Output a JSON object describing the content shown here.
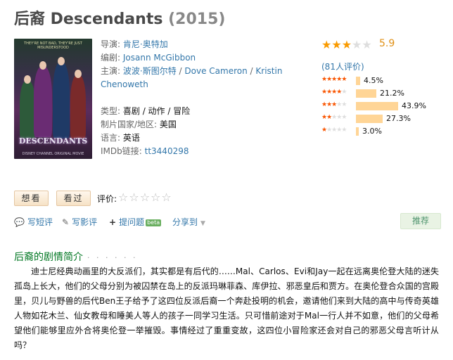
{
  "movie": {
    "title": "后裔 Descendants",
    "year": "(2015)"
  },
  "poster": {
    "tagline": "THEY'RE NOT BAD, THEY'RE JUST MISUNDERSTOOD",
    "logo_text": "DESCENDANTS",
    "bottom_text": "DISNEY CHANNEL ORIGINAL MOVIE"
  },
  "info": {
    "director_label": "导演:",
    "director": "肯尼·奥特加",
    "writer_label": "编剧:",
    "writer": "Josann McGibbon",
    "cast_label": "主演:",
    "cast": [
      "波波·斯图尔特",
      "Dove Cameron",
      "Kristin Chenoweth"
    ],
    "cast_sep": "/",
    "genre_label": "类型:",
    "genre": "喜剧 / 动作 / 冒险",
    "country_label": "制片国家/地区:",
    "country": "美国",
    "language_label": "语言:",
    "language": "英语",
    "imdb_label": "IMDb链接:",
    "imdb": "tt3440298"
  },
  "rating": {
    "score": "5.9",
    "stars_filled": 3,
    "stars_total": 5,
    "count_text": "(81人评价)",
    "distribution": [
      {
        "stars": 5,
        "percent": 4.5,
        "label": "4.5%"
      },
      {
        "stars": 4,
        "percent": 21.2,
        "label": "21.2%"
      },
      {
        "stars": 3,
        "percent": 43.9,
        "label": "43.9%"
      },
      {
        "stars": 2,
        "percent": 27.3,
        "label": "27.3%"
      },
      {
        "stars": 1,
        "percent": 3.0,
        "label": "3.0%"
      }
    ],
    "colors": {
      "star_on": "#f99b01",
      "star_off": "#dedede",
      "bar": "#ffd596",
      "score": "#e09015"
    }
  },
  "actions": {
    "want_label": "想看",
    "seen_label": "看过",
    "rate_label": "评价:",
    "rate_stars": "☆☆☆☆☆"
  },
  "toolbar": {
    "short_review": "写短评",
    "review": "写影评",
    "ask": "提问题",
    "ask_badge": "beta",
    "share": "分享到",
    "recommend": "推荐"
  },
  "synopsis": {
    "heading": "后裔的剧情简介",
    "dots": "· · · · · ·",
    "text": "迪士尼经典动画里的大反派们，其实都是有后代的……Mal、Carlos、Evi和Jay一起在远离奥伦登大陆的迷失孤岛上长大，他们的父母分别为被囚禁在岛上的反派玛琳菲森、库伊拉、邪恶皇后和贾方。在奥伦登合众国的宫殿里，贝儿与野兽的后代Ben王子给予了这四位反派后裔一个奔赴投明的机会，邀请他们来到大陆的高中与传奇英雄人物如花木兰、仙女教母和睡美人等人的孩子一同学习生活。只可惜前途对于Mal一行人并不如意，他们的父母希望他们能够里应外合将奥伦登一举摧毁。事情经过了重重变故，这四位小冒险家还会对自己的邪恶父母言听计从吗？"
  }
}
